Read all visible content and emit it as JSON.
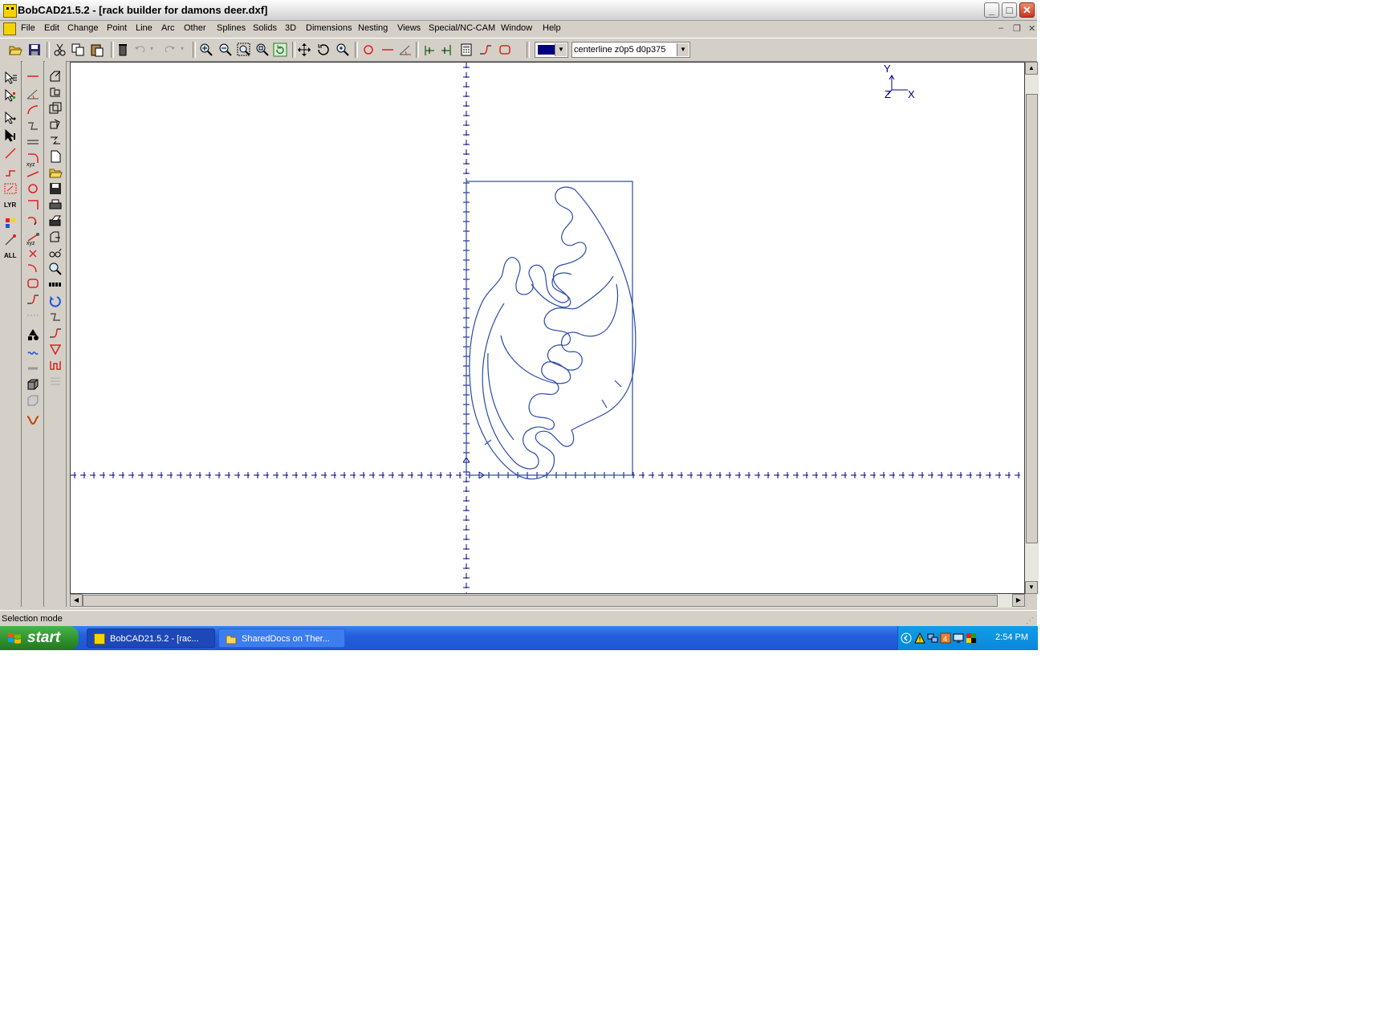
{
  "window": {
    "title": "BobCAD21.5.2 - [rack builder for damons deer.dxf]",
    "minimize_icon": "minimize-icon",
    "maximize_icon": "maximize-icon",
    "close_icon": "close-icon"
  },
  "menu": {
    "items": [
      "File",
      "Edit",
      "Change",
      "Point",
      "Line",
      "Arc",
      "Other",
      "Splines",
      "Solids",
      "3D",
      "Dimensions",
      "Nesting",
      "Views",
      "Special/NC-CAM",
      "Window",
      "Help"
    ]
  },
  "toolbar": {
    "color_value": "#000080",
    "layer_value": "centerline z0p5 d0p375"
  },
  "left_toolbar_1": {
    "labels": {
      "lyr": "LYR",
      "all": "ALL"
    }
  },
  "left_toolbar_2": {
    "labels": {
      "xyz_a": "xyz",
      "xyz_b": "xyz"
    }
  },
  "axis_indicator": {
    "y": "Y",
    "z": "Z",
    "x": "X"
  },
  "status": {
    "text": "Selection mode"
  },
  "taskbar": {
    "start_label": "start",
    "tasks": [
      {
        "label": "BobCAD21.5.2 - [rac..."
      },
      {
        "label": "SharedDocs on Ther..."
      }
    ],
    "clock": "2:54 PM"
  },
  "colors": {
    "drawing": "#2a4ba8",
    "axis": "#000080",
    "taskbar": "#245edc",
    "start": "#2e8f2e"
  }
}
